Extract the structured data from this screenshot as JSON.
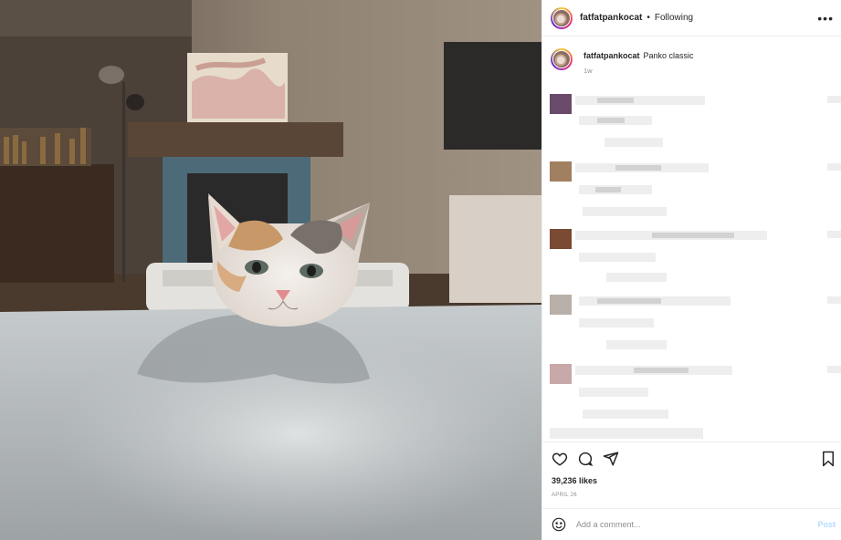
{
  "post": {
    "username": "fatfatpankocat",
    "separator": "•",
    "follow_status": "Following",
    "more_icon": "more-horizontal-icon",
    "photo_subject": "calico-cat-resting-chin-on-table"
  },
  "caption": {
    "username": "fatfatpankocat",
    "text": "Panko classic",
    "time": "1w"
  },
  "actions": {
    "like_icon": "heart-outline-icon",
    "comment_icon": "speech-bubble-icon",
    "share_icon": "paper-plane-icon",
    "save_icon": "bookmark-outline-icon",
    "likes": "39,236 likes",
    "date": "APRIL 26"
  },
  "add_comment": {
    "placeholder": "Add a comment...",
    "post_label": "Post",
    "emoji_icon": "smiley-icon"
  },
  "colors": {
    "text": "#262626",
    "secondary": "#8e8e8e",
    "post_disabled": "#b3dbff",
    "border": "#efefef"
  }
}
